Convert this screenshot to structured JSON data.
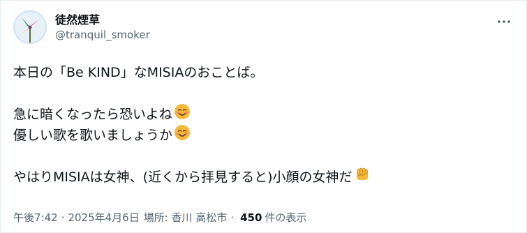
{
  "author": {
    "display_name": "徒然煙草",
    "handle": "@tranquil_smoker"
  },
  "tweet": {
    "line1": "本日の「Be KIND」なMISIAのおことば。",
    "line2": "急に暗くなったら恐いよね",
    "line3": "優しい歌を歌いましょうか",
    "line4": "やはりMISIAは女神、(近くから拝見すると)小顔の女神だ"
  },
  "meta": {
    "time": "午後7:42",
    "separator": "·",
    "date": "2025年4月6日",
    "location_label": "場所: 香川 高松市",
    "views_count": "450",
    "views_label": "件の表示"
  },
  "icons": {
    "more": "more-dots-icon",
    "smile": "smiling-face-emoji",
    "fist": "raised-fist-emoji",
    "avatar": "pinwheel-avatar"
  }
}
